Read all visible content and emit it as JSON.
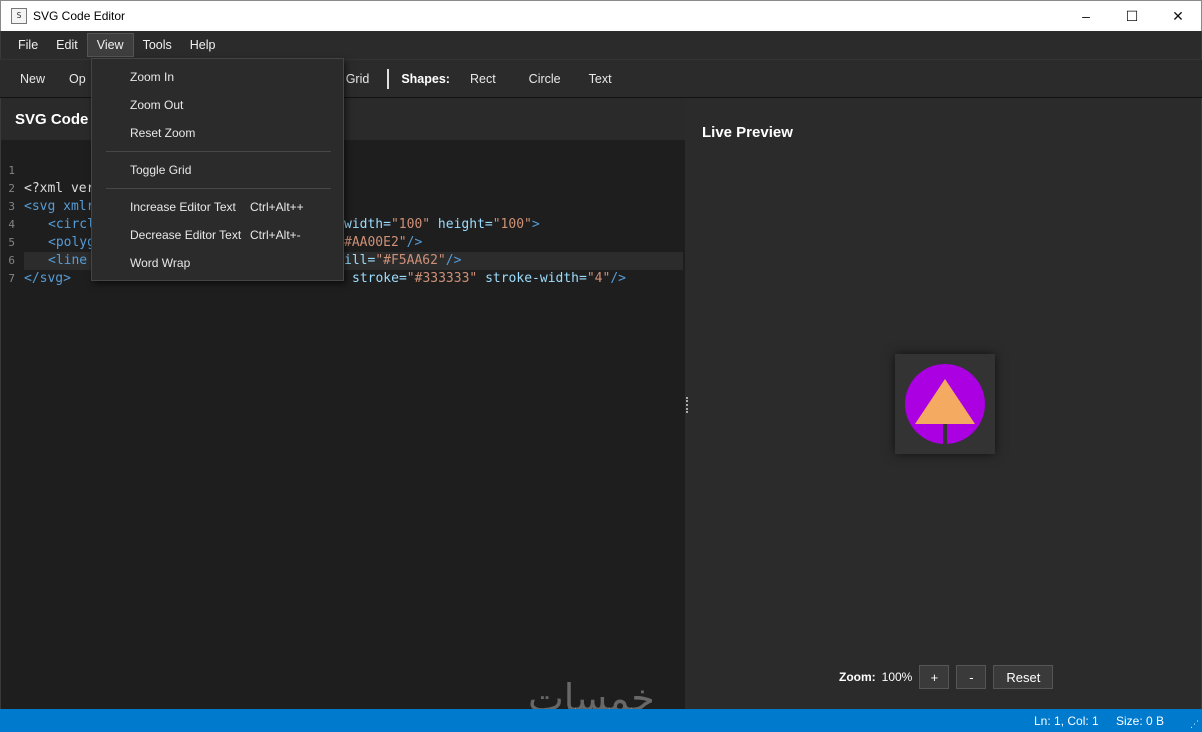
{
  "window": {
    "title": "SVG Code Editor",
    "icon_text": "S",
    "controls": [
      "–",
      "☐",
      "✕"
    ]
  },
  "menubar": {
    "items": [
      "File",
      "Edit",
      "View",
      "Tools",
      "Help"
    ]
  },
  "toolbar": {
    "new": "New",
    "open_partial": "Op",
    "grid": "Grid",
    "shapes_label": "Shapes:",
    "rect": "Rect",
    "circle": "Circle",
    "text": "Text"
  },
  "editor": {
    "title": "SVG Code",
    "line_numbers": [
      "1",
      "2",
      "3",
      "4",
      "5",
      "6",
      "7"
    ],
    "lines": {
      "l1": "<?xml ver",
      "l2a": "<svg xmlr",
      "l2b_attr1": "width=",
      "l2b_val1": "\"100\"",
      "l2b_attr2": " height=",
      "l2b_val2": "\"100\"",
      "l2b_end": ">",
      "l3a": "<circl",
      "l3b_val": "#AA00E2\"",
      "l3b_end": "/>",
      "l4a": "<polyg",
      "l4b_attr": "ill=",
      "l4b_val": "\"#F5AA62\"",
      "l4b_end": "/>",
      "l5a": "<line",
      "l5b_attr1": "stroke=",
      "l5b_val1": "\"#333333\"",
      "l5b_attr2": " stroke-width=",
      "l5b_val2": "\"4\"",
      "l5b_end": "/>",
      "l6": "</svg>"
    }
  },
  "view_menu": {
    "zoom_in": "Zoom In",
    "zoom_out": "Zoom Out",
    "reset_zoom": "Reset Zoom",
    "toggle_grid": "Toggle Grid",
    "increase_text": "Increase Editor Text",
    "increase_shortcut": "Ctrl+Alt++",
    "decrease_text": "Decrease Editor Text",
    "decrease_shortcut": "Ctrl+Alt+-",
    "word_wrap": "Word Wrap"
  },
  "preview": {
    "title": "Live Preview",
    "zoom_label": "Zoom:",
    "zoom_value": "100%",
    "plus": "+",
    "minus": "-",
    "reset": "Reset",
    "colors": {
      "circle_fill": "#AA00E2",
      "triangle_fill": "#F5AA62",
      "line_stroke": "#333333",
      "canvas_bg": "#333333"
    }
  },
  "status": {
    "position": "Ln: 1, Col: 1",
    "size": "Size: 0 B"
  },
  "watermark": "خمسات",
  "colors": {
    "accent": "#007acc",
    "editor_bg": "#1e1e1e",
    "panel_bg": "#2b2b2b"
  }
}
